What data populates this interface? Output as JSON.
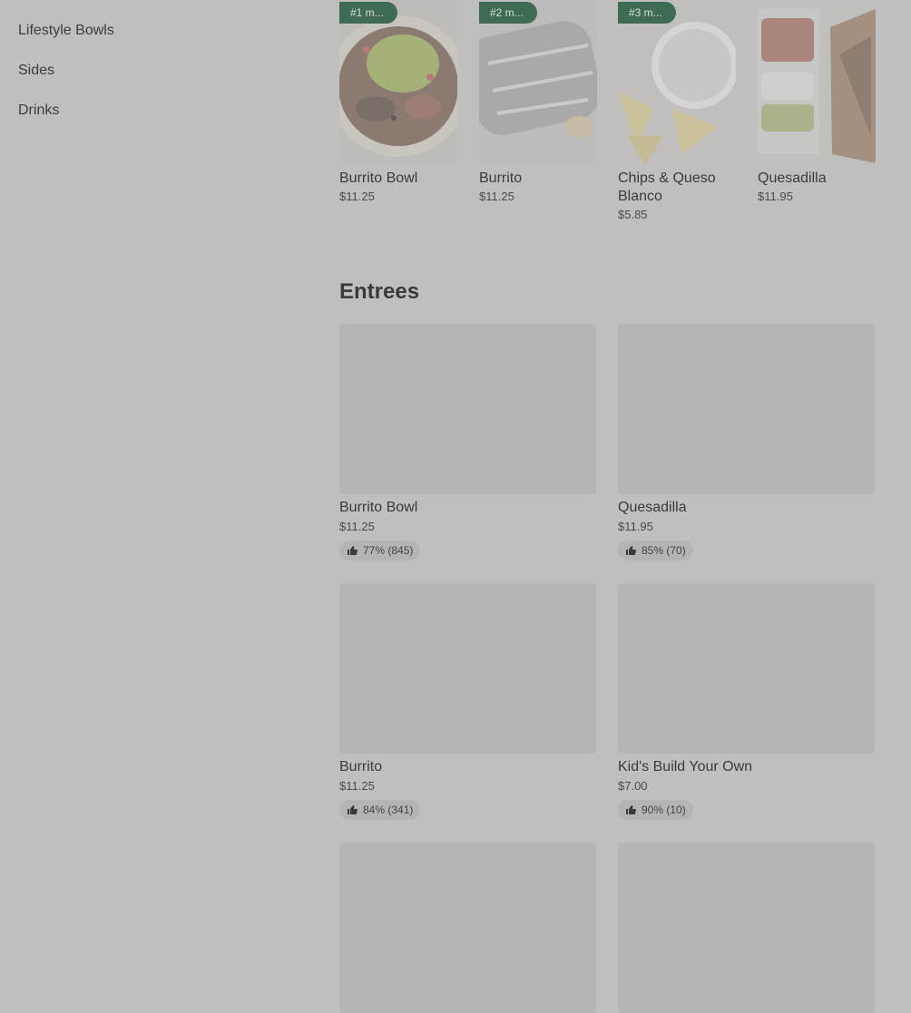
{
  "sidebar": {
    "items": [
      {
        "label": "Lifestyle Bowls"
      },
      {
        "label": "Sides"
      },
      {
        "label": "Drinks"
      }
    ]
  },
  "popular": {
    "items": [
      {
        "badge": "#1 m...",
        "name": "Burrito Bowl",
        "price": "$11.25"
      },
      {
        "badge": "#2 m...",
        "name": "Burrito",
        "price": "$11.25"
      },
      {
        "badge": "#3 m...",
        "name": "Chips & Queso Blanco",
        "price": "$5.85"
      },
      {
        "badge": "",
        "name": "Quesadilla",
        "price": "$11.95"
      }
    ]
  },
  "entrees": {
    "title": "Entrees",
    "items": [
      {
        "name": "Burrito Bowl",
        "price": "$11.25",
        "rating": "77% (845)"
      },
      {
        "name": "Quesadilla",
        "price": "$11.95",
        "rating": "85% (70)"
      },
      {
        "name": "Burrito",
        "price": "$11.25",
        "rating": "84% (341)"
      },
      {
        "name": "Kid's Build Your Own",
        "price": "$7.00",
        "rating": "90% (10)"
      },
      {
        "name": "",
        "price": "",
        "rating": ""
      },
      {
        "name": "",
        "price": "",
        "rating": ""
      }
    ]
  },
  "colors": {
    "overlay": "#bfbfbf",
    "badge": "#3f6b54"
  }
}
